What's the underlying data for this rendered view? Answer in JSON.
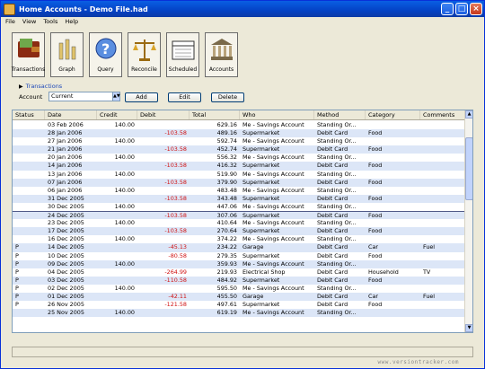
{
  "window": {
    "title": "Home Accounts - Demo File.had"
  },
  "menu": [
    "File",
    "View",
    "Tools",
    "Help"
  ],
  "toolbar": [
    {
      "label": "Transactions",
      "icon": "wallet-icon"
    },
    {
      "label": "Graph",
      "icon": "graph-icon"
    },
    {
      "label": "Query",
      "icon": "query-icon"
    },
    {
      "label": "Reconcile",
      "icon": "scales-icon"
    },
    {
      "label": "Scheduled",
      "icon": "calendar-icon"
    },
    {
      "label": "Accounts",
      "icon": "bank-icon"
    }
  ],
  "transactions_link": "Transactions",
  "account": {
    "label": "Account",
    "value": "Current"
  },
  "buttons": {
    "add": "Add",
    "edit": "Edit",
    "delete": "Delete"
  },
  "columns": [
    "Status",
    "Date",
    "Credit",
    "Debit",
    "Total",
    "Who",
    "Method",
    "Category",
    "Comments"
  ],
  "rows": [
    {
      "status": "",
      "date": "03 Feb 2006",
      "credit": "140.00",
      "debit": "",
      "total": "629.16",
      "who": "Me - Savings Account",
      "method": "Standing Or...",
      "category": "",
      "comments": ""
    },
    {
      "status": "",
      "date": "28 Jan 2006",
      "credit": "",
      "debit": "-103.58",
      "total": "489.16",
      "who": "Supermarket",
      "method": "Debit Card",
      "category": "Food",
      "comments": ""
    },
    {
      "status": "",
      "date": "27 Jan 2006",
      "credit": "140.00",
      "debit": "",
      "total": "592.74",
      "who": "Me - Savings Account",
      "method": "Standing Or...",
      "category": "",
      "comments": ""
    },
    {
      "status": "",
      "date": "21 Jan 2006",
      "credit": "",
      "debit": "-103.58",
      "total": "452.74",
      "who": "Supermarket",
      "method": "Debit Card",
      "category": "Food",
      "comments": ""
    },
    {
      "status": "",
      "date": "20 Jan 2006",
      "credit": "140.00",
      "debit": "",
      "total": "556.32",
      "who": "Me - Savings Account",
      "method": "Standing Or...",
      "category": "",
      "comments": ""
    },
    {
      "status": "",
      "date": "14 Jan 2006",
      "credit": "",
      "debit": "-103.58",
      "total": "416.32",
      "who": "Supermarket",
      "method": "Debit Card",
      "category": "Food",
      "comments": ""
    },
    {
      "status": "",
      "date": "13 Jan 2006",
      "credit": "140.00",
      "debit": "",
      "total": "519.90",
      "who": "Me - Savings Account",
      "method": "Standing Or...",
      "category": "",
      "comments": ""
    },
    {
      "status": "",
      "date": "07 Jan 2006",
      "credit": "",
      "debit": "-103.58",
      "total": "379.90",
      "who": "Supermarket",
      "method": "Debit Card",
      "category": "Food",
      "comments": ""
    },
    {
      "status": "",
      "date": "06 Jan 2006",
      "credit": "140.00",
      "debit": "",
      "total": "483.48",
      "who": "Me - Savings Account",
      "method": "Standing Or...",
      "category": "",
      "comments": ""
    },
    {
      "status": "",
      "date": "31 Dec 2005",
      "credit": "",
      "debit": "-103.58",
      "total": "343.48",
      "who": "Supermarket",
      "method": "Debit Card",
      "category": "Food",
      "comments": ""
    },
    {
      "status": "",
      "date": "30 Dec 2005",
      "credit": "140.00",
      "debit": "",
      "total": "447.06",
      "who": "Me - Savings Account",
      "method": "Standing Or...",
      "category": "",
      "comments": ""
    },
    {
      "status": "",
      "date": "24 Dec 2005",
      "credit": "",
      "debit": "-103.58",
      "total": "307.06",
      "who": "Supermarket",
      "method": "Debit Card",
      "category": "Food",
      "comments": ""
    },
    {
      "status": "",
      "date": "23 Dec 2005",
      "credit": "140.00",
      "debit": "",
      "total": "410.64",
      "who": "Me - Savings Account",
      "method": "Standing Or...",
      "category": "",
      "comments": ""
    },
    {
      "status": "",
      "date": "17 Dec 2005",
      "credit": "",
      "debit": "-103.58",
      "total": "270.64",
      "who": "Supermarket",
      "method": "Debit Card",
      "category": "Food",
      "comments": ""
    },
    {
      "status": "",
      "date": "16 Dec 2005",
      "credit": "140.00",
      "debit": "",
      "total": "374.22",
      "who": "Me - Savings Account",
      "method": "Standing Or...",
      "category": "",
      "comments": ""
    },
    {
      "status": "P",
      "date": "14 Dec 2005",
      "credit": "",
      "debit": "-45.13",
      "total": "234.22",
      "who": "Garage",
      "method": "Debit Card",
      "category": "Car",
      "comments": "Fuel"
    },
    {
      "status": "P",
      "date": "10 Dec 2005",
      "credit": "",
      "debit": "-80.58",
      "total": "279.35",
      "who": "Supermarket",
      "method": "Debit Card",
      "category": "Food",
      "comments": ""
    },
    {
      "status": "P",
      "date": "09 Dec 2005",
      "credit": "140.00",
      "debit": "",
      "total": "359.93",
      "who": "Me - Savings Account",
      "method": "Standing Or...",
      "category": "",
      "comments": ""
    },
    {
      "status": "P",
      "date": "04 Dec 2005",
      "credit": "",
      "debit": "-264.99",
      "total": "219.93",
      "who": "Electrical Shop",
      "method": "Debit Card",
      "category": "Household",
      "comments": "TV"
    },
    {
      "status": "P",
      "date": "03 Dec 2005",
      "credit": "",
      "debit": "-110.58",
      "total": "484.92",
      "who": "Supermarket",
      "method": "Debit Card",
      "category": "Food",
      "comments": ""
    },
    {
      "status": "P",
      "date": "02 Dec 2005",
      "credit": "140.00",
      "debit": "",
      "total": "595.50",
      "who": "Me - Savings Account",
      "method": "Standing Or...",
      "category": "",
      "comments": ""
    },
    {
      "status": "P",
      "date": "01 Dec 2005",
      "credit": "",
      "debit": "-42.11",
      "total": "455.50",
      "who": "Garage",
      "method": "Debit Card",
      "category": "Car",
      "comments": "Fuel"
    },
    {
      "status": "P",
      "date": "26 Nov 2005",
      "credit": "",
      "debit": "-121.58",
      "total": "497.61",
      "who": "Supermarket",
      "method": "Debit Card",
      "category": "Food",
      "comments": ""
    },
    {
      "status": "",
      "date": "25 Nov 2005",
      "credit": "140.00",
      "debit": "",
      "total": "619.19",
      "who": "Me - Savings Account",
      "method": "Standing Or...",
      "category": "",
      "comments": ""
    }
  ],
  "watermark": "www.versiontracker.com"
}
